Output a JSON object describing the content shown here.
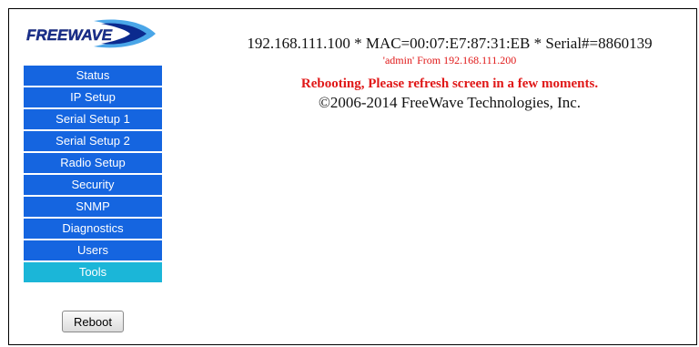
{
  "logo": {
    "text": "FREEWAVE",
    "colors": {
      "text": "#1a2f8c",
      "swoosh_dark": "#0b2a8e",
      "swoosh_light": "#4aa6e8"
    }
  },
  "sidebar": {
    "items": [
      {
        "label": "Status",
        "active": false
      },
      {
        "label": "IP Setup",
        "active": false
      },
      {
        "label": "Serial Setup 1",
        "active": false
      },
      {
        "label": "Serial Setup 2",
        "active": false
      },
      {
        "label": "Radio Setup",
        "active": false
      },
      {
        "label": "Security",
        "active": false
      },
      {
        "label": "SNMP",
        "active": false
      },
      {
        "label": "Diagnostics",
        "active": false
      },
      {
        "label": "Users",
        "active": false
      },
      {
        "label": "Tools",
        "active": true
      }
    ],
    "colors": {
      "item_bg": "#1565e0",
      "active_bg": "#1bb6d8",
      "text": "#ffffff"
    }
  },
  "reboot_button": {
    "label": "Reboot"
  },
  "main": {
    "device_info": "192.168.111.100 * MAC=00:07:E7:87:31:EB * Serial#=8860139",
    "login_info": "'admin' From 192.168.111.200",
    "status_message": "Rebooting, Please refresh screen in a few moments.",
    "copyright": "©2006-2014 FreeWave Technologies, Inc.",
    "colors": {
      "alert": "#e01818",
      "text": "#111111"
    }
  }
}
